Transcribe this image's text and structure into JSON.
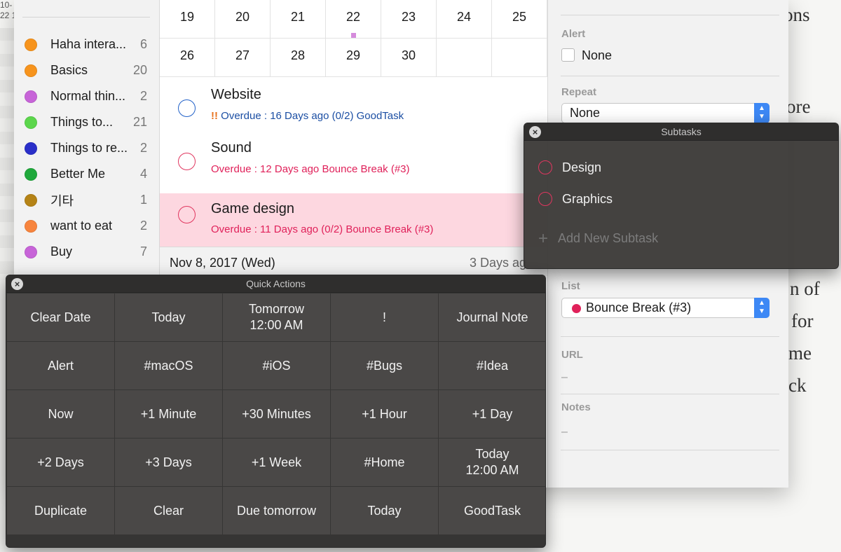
{
  "background": {
    "corner_lines": [
      "10-",
      "22 1"
    ],
    "words": [
      "ons",
      "ore",
      "n of",
      "for",
      "me",
      "ck"
    ]
  },
  "sidebar": {
    "items": [
      {
        "label": "Haha intera...",
        "count": "6",
        "color": "#f7941d"
      },
      {
        "label": "Basics",
        "count": "20",
        "color": "#f7941d"
      },
      {
        "label": "Normal thin...",
        "count": "2",
        "color": "#c764d8"
      },
      {
        "label": "Things to...",
        "count": "21",
        "color": "#5cd64c"
      },
      {
        "label": "Things to re...",
        "count": "2",
        "color": "#2a2fc9"
      },
      {
        "label": "Better Me",
        "count": "4",
        "color": "#1fa83b"
      },
      {
        "label": "기타",
        "count": "1",
        "color": "#b58316"
      },
      {
        "label": "want to eat",
        "count": "2",
        "color": "#f7843d"
      },
      {
        "label": "Buy",
        "count": "7",
        "color": "#c764d8"
      }
    ]
  },
  "calendar": {
    "rows": [
      [
        "19",
        "20",
        "21",
        "22",
        "23",
        "24",
        "25"
      ],
      [
        "26",
        "27",
        "28",
        "29",
        "30",
        "",
        ""
      ]
    ]
  },
  "tasks": [
    {
      "title": "Website",
      "warning": "!!",
      "meta": "Overdue : 16 Days ago (0/2)",
      "list": "GoodTask",
      "color": "#1b4ea3"
    },
    {
      "title": "Sound",
      "warning": "",
      "meta": "Overdue : 12 Days ago",
      "list": "Bounce Break (#3)",
      "color": "#e0215a"
    },
    {
      "title": "Game design",
      "warning": "",
      "meta": "Overdue : 11 Days ago (0/2)",
      "list": "Bounce Break (#3)",
      "color": "#e0215a"
    }
  ],
  "date_header": {
    "date": "Nov 8, 2017 (Wed)",
    "relative": "3 Days ag"
  },
  "detail": {
    "alert_label": "Alert",
    "alert_value": "None",
    "repeat_label": "Repeat",
    "repeat_value": "None",
    "list_label": "List",
    "list_value": "Bounce Break (#3)",
    "url_label": "URL",
    "url_value": "–",
    "notes_label": "Notes",
    "notes_value": "–"
  },
  "subtasks": {
    "title": "Subtasks",
    "items": [
      "Design",
      "Graphics"
    ],
    "add_placeholder": "Add New Subtask"
  },
  "quick_actions": {
    "title": "Quick Actions",
    "buttons": [
      "Clear Date",
      "Today",
      "Tomorrow\n12:00 AM",
      "!",
      "Journal Note",
      "Alert",
      "#macOS",
      "#iOS",
      "#Bugs",
      "#Idea",
      "Now",
      "+1 Minute",
      "+30 Minutes",
      "+1 Hour",
      "+1 Day",
      "+2 Days",
      "+3 Days",
      "+1 Week",
      "#Home",
      "Today\n12:00 AM",
      "Duplicate",
      "Clear",
      "Due tomorrow",
      "Today",
      "GoodTask"
    ]
  },
  "colors": {
    "accent_blue": "#3d88f5",
    "overdue_red": "#e0215a",
    "selected_row": "#fdd7e0"
  }
}
